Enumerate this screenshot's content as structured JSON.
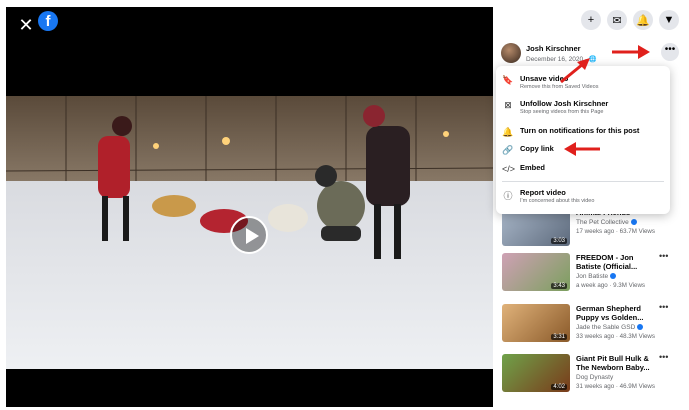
{
  "player": {
    "close_icon": "close-icon",
    "logo_icon": "facebook-logo-icon",
    "play_icon": "play-icon"
  },
  "header_icons": [
    "plus-icon",
    "messenger-icon",
    "bell-icon",
    "caret-down-icon"
  ],
  "author": {
    "name": "Josh Kirschner",
    "date": "December 16, 2020",
    "privacy_icon": "globe-icon",
    "more_icon": "more-icon"
  },
  "menu": {
    "items": [
      {
        "icon": "bookmark-icon",
        "title": "Unsave video",
        "sub": "Remove this from Saved Videos"
      },
      {
        "icon": "unfollow-icon",
        "title": "Unfollow Josh Kirschner",
        "sub": "Stop seeing videos from this Page"
      },
      {
        "icon": "bell-icon",
        "title": "Turn on notifications for this post",
        "sub": ""
      },
      {
        "icon": "link-icon",
        "title": "Copy link",
        "sub": ""
      },
      {
        "icon": "code-icon",
        "title": "Embed",
        "sub": ""
      },
      {
        "icon": "report-icon",
        "title": "Report video",
        "sub": "I'm concerned about this video"
      }
    ]
  },
  "videos": [
    {
      "title": "Animal Friends",
      "channel": "The Pet Collective",
      "verified": true,
      "meta": "17 weeks ago · 63.7M Views",
      "duration": "3:03"
    },
    {
      "title": "FREEDOM - Jon Batiste (Official...",
      "channel": "Jon Batiste",
      "verified": true,
      "meta": "a week ago · 9.3M Views",
      "duration": "3:43"
    },
    {
      "title": "German Shepherd Puppy vs Golden...",
      "channel": "Jade the Sable GSD",
      "verified": true,
      "meta": "33 weeks ago · 48.3M Views",
      "duration": "3:31"
    },
    {
      "title": "Giant Pit Bull Hulk & The Newborn Baby...",
      "channel": "Dog Dynasty",
      "verified": false,
      "meta": "31 weeks ago · 46.9M Views",
      "duration": "4:02"
    }
  ],
  "colors": {
    "brand": "#1877f2",
    "annotation_arrow": "#e0201c"
  }
}
